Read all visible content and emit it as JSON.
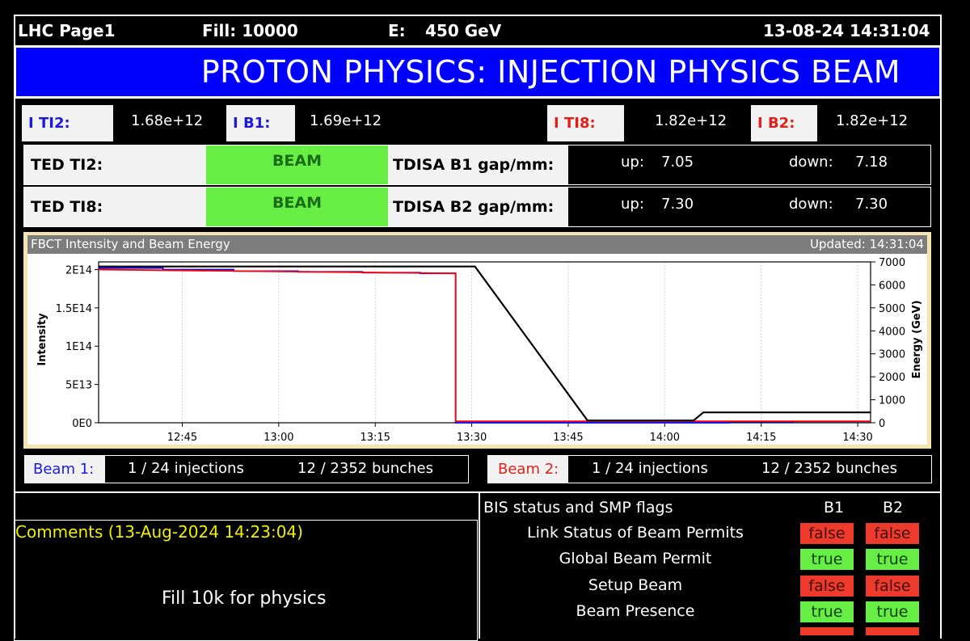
{
  "header": {
    "page": "LHC Page1",
    "fill": "Fill: 10000",
    "energy_label": "E:",
    "energy_value": "450 GeV",
    "datetime": "13-08-24 14:31:04"
  },
  "banner": {
    "title": "PROTON PHYSICS: INJECTION PHYSICS BEAM",
    "color": "#0000ff"
  },
  "intensities": {
    "ti2_label": "I TI2:",
    "ti2_value": "1.68e+12",
    "b1_label": "I B1:",
    "b1_value": "1.69e+12",
    "ti8_label": "I TI8:",
    "ti8_value": "1.82e+12",
    "b2_label": "I B2:",
    "b2_value": "1.82e+12"
  },
  "ted": {
    "ti2_label": "TED TI2:",
    "ti2_state": "BEAM",
    "ti8_label": "TED TI8:",
    "ti8_state": "BEAM"
  },
  "tdisa": {
    "b1_label": "TDISA B1 gap/mm:",
    "b2_label": "TDISA B2 gap/mm:",
    "up_label": "up:",
    "down_label": "down:",
    "b1_up": "7.05",
    "b1_down": "7.18",
    "b2_up": "7.30",
    "b2_down": "7.30"
  },
  "chart_panel": {
    "title": "FBCT Intensity and Beam Energy",
    "updated": "Updated: 14:31:04"
  },
  "chart_data": {
    "type": "line",
    "xlabel": "",
    "ylabel": "Intensity",
    "y2label": "Energy (GeV)",
    "x_tick_labels": [
      "12:45",
      "13:00",
      "13:15",
      "13:30",
      "13:45",
      "14:00",
      "14:15",
      "14:30"
    ],
    "x_tick_minutes": [
      765,
      780,
      795,
      810,
      825,
      840,
      855,
      870
    ],
    "xlim_minutes": [
      752,
      872
    ],
    "y_tick_labels": [
      "0E0",
      "5E13",
      "1E14",
      "1.5E14",
      "2E14"
    ],
    "y_tick_values": [
      0,
      50000000000000.0,
      100000000000000.0,
      150000000000000.0,
      200000000000000.0
    ],
    "ylim": [
      0,
      210000000000000.0
    ],
    "y2_tick_labels": [
      "0",
      "1000",
      "2000",
      "3000",
      "4000",
      "5000",
      "6000",
      "7000"
    ],
    "y2_tick_values": [
      0,
      1000,
      2000,
      3000,
      4000,
      5000,
      6000,
      7000
    ],
    "y2lim": [
      0,
      7000
    ],
    "series": [
      {
        "color": "#0000ff",
        "axis": "left",
        "x": [
          752,
          762,
          762,
          773,
          773,
          783,
          783,
          793,
          793,
          802,
          802,
          807,
          807,
          807.5,
          807.5,
          850,
          850,
          860,
          860,
          872
        ],
        "y": [
          202000000000000.0,
          202000000000000.0,
          200000000000000.0,
          200000000000000.0,
          198000000000000.0,
          198000000000000.0,
          197000000000000.0,
          197000000000000.0,
          196000000000000.0,
          196000000000000.0,
          195000000000000.0,
          195000000000000.0,
          195000000000000.0,
          195000000000000.0,
          0,
          0,
          1200000000000.0,
          1200000000000.0,
          1700000000000.0,
          1700000000000.0
        ]
      },
      {
        "color": "#ff0000",
        "axis": "left",
        "x": [
          752,
          807.5,
          807.5,
          872
        ],
        "y": [
          200000000000000.0,
          195000000000000.0,
          2000000000000.0,
          2000000000000.0
        ]
      },
      {
        "color": "#000000",
        "axis": "right",
        "x": [
          752,
          810.5,
          828,
          842,
          844.5,
          846,
          872
        ],
        "y": [
          6800,
          6800,
          100,
          100,
          100,
          450,
          450
        ]
      }
    ]
  },
  "beam_summary": {
    "beam1_label": "Beam 1:",
    "beam1_injections": "1 / 24 injections",
    "beam1_bunches": "12 / 2352 bunches",
    "beam2_label": "Beam 2:",
    "beam2_injections": "1 / 24 injections",
    "beam2_bunches": "12 / 2352 bunches"
  },
  "comments": {
    "title": "Comments (13-Aug-2024 14:23:04)",
    "text": "Fill 10k for physics"
  },
  "bis": {
    "title": "BIS status and SMP flags",
    "col_b1": "B1",
    "col_b2": "B2",
    "rows": [
      {
        "label": "Link Status of Beam Permits",
        "b1": "false",
        "b2": "false"
      },
      {
        "label": "Global Beam Permit",
        "b1": "true",
        "b2": "true"
      },
      {
        "label": "Setup Beam",
        "b1": "false",
        "b2": "false"
      },
      {
        "label": "Beam Presence",
        "b1": "true",
        "b2": "true"
      }
    ]
  }
}
